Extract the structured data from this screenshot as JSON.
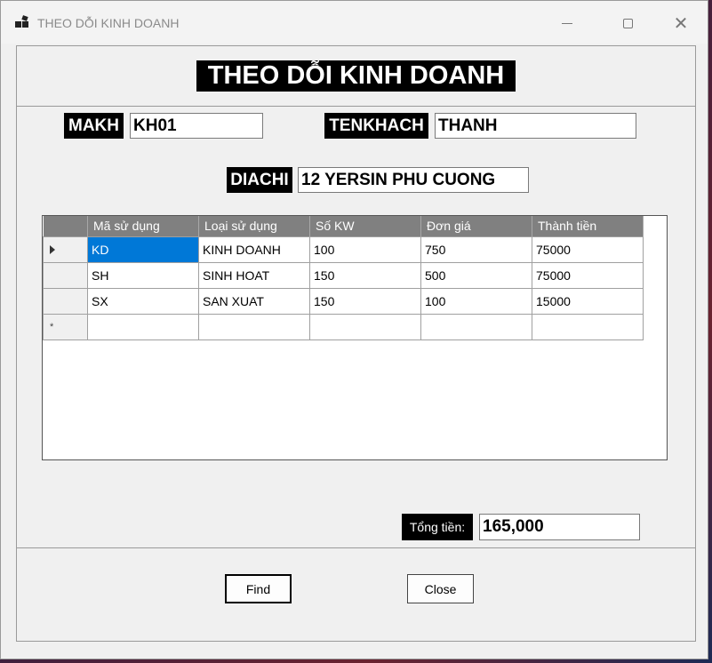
{
  "window": {
    "title": "THEO DỖI KINH DOANH",
    "controls": {
      "minimize": "",
      "maximize": "",
      "close": "✕"
    }
  },
  "form": {
    "heading": "THEO DỖI KINH DOANH",
    "makh": {
      "label": "MAKH",
      "value": "KH01"
    },
    "tenkhach": {
      "label": "TENKHACH",
      "value": "THANH"
    },
    "diachi": {
      "label": "DIACHI",
      "value": "12 YERSIN PHU CUONG"
    }
  },
  "grid": {
    "columns": [
      "Mã sử dụng",
      "Loại sử dụng",
      "Số KW",
      "Đơn giá",
      "Thành tiền"
    ],
    "rows": [
      [
        "KD",
        "KINH DOANH",
        "100",
        "750",
        "75000"
      ],
      [
        "SH",
        "SINH HOAT",
        "150",
        "500",
        "75000"
      ],
      [
        "SX",
        "SAN XUAT",
        "150",
        "100",
        "15000"
      ]
    ],
    "new_row_marker": "*"
  },
  "total": {
    "label": "Tổng tiền:",
    "value": "165,000"
  },
  "buttons": {
    "find": "Find",
    "close": "Close"
  }
}
